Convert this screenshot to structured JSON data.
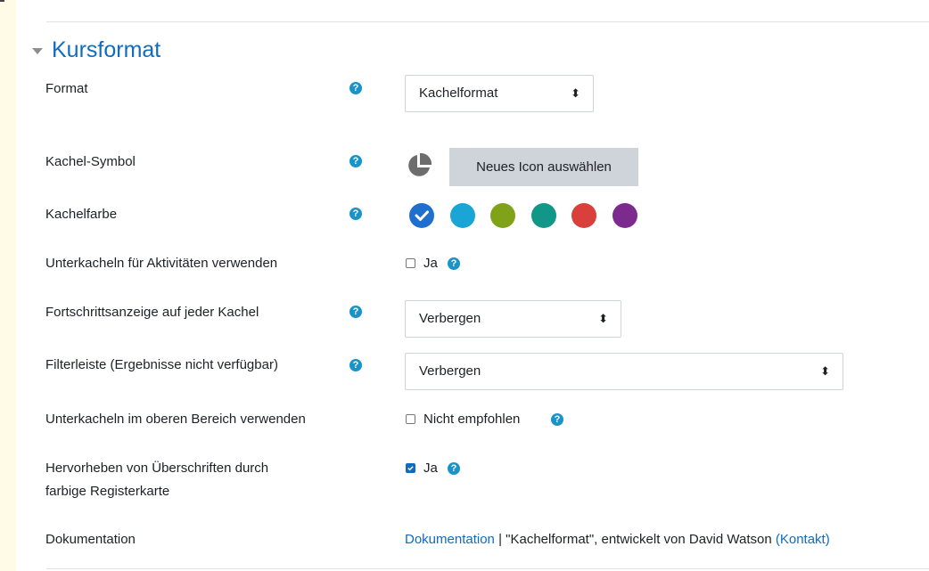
{
  "section": {
    "title": "Kursformat"
  },
  "format": {
    "label": "Format",
    "value": "Kachelformat"
  },
  "kachel_symbol": {
    "label": "Kachel-Symbol",
    "button_label": "Neues Icon auswählen"
  },
  "kachelfarbe": {
    "label": "Kachelfarbe",
    "colors": [
      "#1f6fd0",
      "#1aa5d6",
      "#7fa219",
      "#119687",
      "#d9403c",
      "#7d2a8f"
    ],
    "selected_index": 0
  },
  "unterkacheln_aktivitaeten": {
    "label": "Unterkacheln für Aktivitäten verwenden",
    "checkbox_label": "Ja",
    "checked": false
  },
  "fortschritt": {
    "label": "Fortschrittsanzeige auf jeder Kachel",
    "value": "Verbergen"
  },
  "filterleiste": {
    "label": "Filterleiste (Ergebnisse nicht verfügbar)",
    "value": "Verbergen"
  },
  "unterkacheln_oben": {
    "label": "Unterkacheln im oberen Bereich verwenden",
    "checkbox_label": "Nicht empfohlen",
    "checked": false
  },
  "hervorheben": {
    "label_line1": "Hervorheben von Überschriften durch",
    "label_line2": "farbige Registerkarte",
    "checkbox_label": "Ja",
    "checked": true
  },
  "dokumentation": {
    "label": "Dokumentation",
    "link_text": "Dokumentation",
    "separator": " | ",
    "text": "\"Kachelformat\", entwickelt von David Watson ",
    "contact_text": "(Kontakt)"
  }
}
